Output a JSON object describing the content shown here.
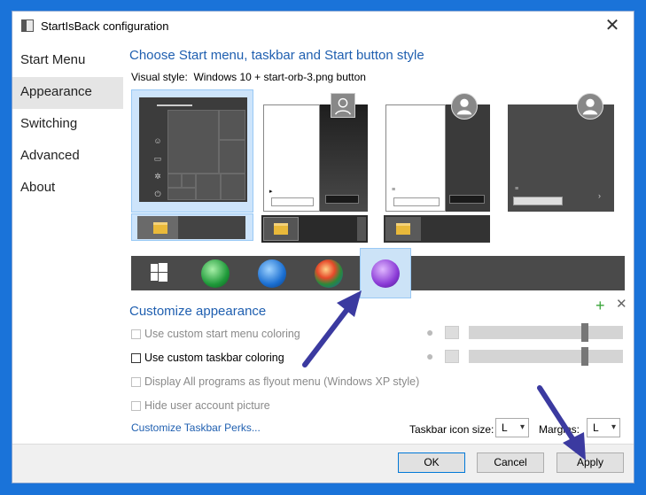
{
  "window": {
    "title": "StartIsBack configuration"
  },
  "sidebar": {
    "items": [
      {
        "label": "Start Menu"
      },
      {
        "label": "Appearance"
      },
      {
        "label": "Switching"
      },
      {
        "label": "Advanced"
      },
      {
        "label": "About"
      }
    ],
    "selected": "Appearance"
  },
  "main": {
    "style_heading": "Choose Start menu, taskbar and Start button style",
    "visual_style_label": "Visual style:",
    "visual_style_value": "Windows 10 + start-orb-3.png button",
    "customize_heading": "Customize appearance",
    "options": [
      {
        "label": "Use custom start menu coloring",
        "checked": false,
        "enabled": false
      },
      {
        "label": "Use custom taskbar coloring",
        "checked": false,
        "enabled": true
      },
      {
        "label": "Display All programs as flyout menu (Windows XP style)",
        "checked": false,
        "enabled": false
      },
      {
        "label": "Hide user account picture",
        "checked": false,
        "enabled": false
      }
    ],
    "link": "Customize Taskbar Perks...",
    "taskbar_icon_size_label": "Taskbar icon size:",
    "taskbar_icon_size_value": "L",
    "margins_label": "Margins:",
    "margins_value": "L"
  },
  "footer": {
    "ok": "OK",
    "cancel": "Cancel",
    "apply": "Apply"
  },
  "colors": {
    "accent": "#1f5fb0",
    "annotation_arrow": "#3b3aa0",
    "desktop": "#1a73d9"
  },
  "icons": [
    "close-icon",
    "plus-icon",
    "remove-icon",
    "drop-icon",
    "chevron-down-icon",
    "folder-icon",
    "user-icon"
  ]
}
